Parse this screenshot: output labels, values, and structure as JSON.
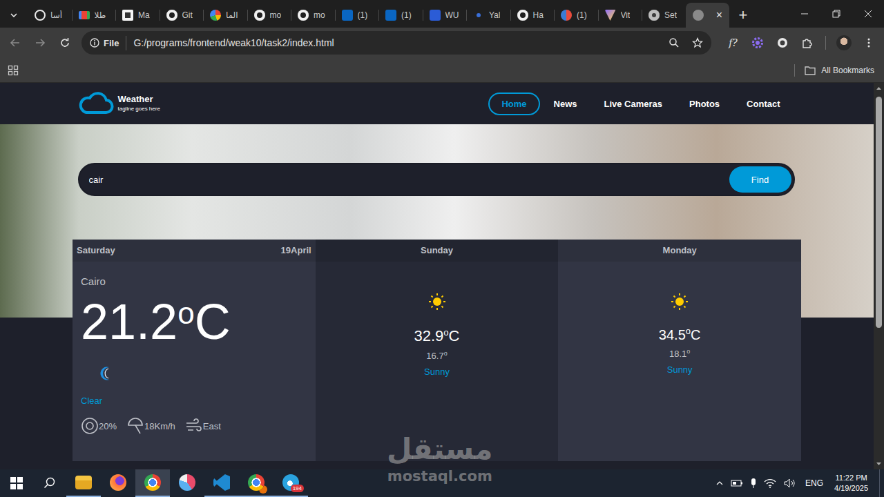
{
  "browser": {
    "tabs": [
      {
        "label": "أسا",
        "kind": "chatgpt",
        "selected": false
      },
      {
        "label": "طلا",
        "kind": "gmail",
        "selected": false
      },
      {
        "label": "Ma",
        "kind": "wiki",
        "selected": false
      },
      {
        "label": "Git",
        "kind": "github",
        "selected": false
      },
      {
        "label": "الما",
        "kind": "google",
        "selected": false
      },
      {
        "label": "mo",
        "kind": "github",
        "selected": false
      },
      {
        "label": "mo",
        "kind": "github",
        "selected": false
      },
      {
        "label": "(1)",
        "kind": "linkedin",
        "selected": false
      },
      {
        "label": "(1)",
        "kind": "linkedin",
        "selected": false
      },
      {
        "label": "WU",
        "kind": "word",
        "selected": false
      },
      {
        "label": "Yal",
        "kind": "yale",
        "selected": false
      },
      {
        "label": "Ha",
        "kind": "github",
        "selected": false
      },
      {
        "label": "(1)",
        "kind": "grammarly",
        "selected": false
      },
      {
        "label": "Vit",
        "kind": "vite",
        "selected": false
      },
      {
        "label": "Set",
        "kind": "settings",
        "selected": false
      },
      {
        "label": "",
        "kind": "globe",
        "selected": true
      }
    ],
    "tab_close": "×",
    "new_tab": "+",
    "address": {
      "scheme_label": "File",
      "url": "G:/programs/frontend/weak10/task2/index.html"
    },
    "extension_label": "f?",
    "bookmarks": {
      "label": "All Bookmarks"
    }
  },
  "page": {
    "brand": {
      "name": "Weather",
      "tagline": "tagline goes here"
    },
    "nav": [
      {
        "label": "Home",
        "selected": true
      },
      {
        "label": "News",
        "selected": false
      },
      {
        "label": "Live Cameras",
        "selected": false
      },
      {
        "label": "Photos",
        "selected": false
      },
      {
        "label": "Contact",
        "selected": false
      }
    ],
    "search": {
      "value": "cair",
      "button": "Find"
    },
    "today": {
      "day": "Saturday",
      "date": "19April",
      "city": "Cairo",
      "temp": "21.2",
      "degree": "o",
      "unit": "C",
      "condition": "Clear",
      "stats": [
        {
          "kind": "rain",
          "value": "20%"
        },
        {
          "kind": "wind",
          "value": "18Km/h"
        },
        {
          "kind": "direction",
          "value": "East"
        }
      ]
    },
    "forecast": [
      {
        "day": "Sunday",
        "max": "32.9",
        "min": "16.7",
        "degree": "o",
        "unit": "C",
        "condition": "Sunny"
      },
      {
        "day": "Monday",
        "max": "34.5",
        "min": "18.1",
        "degree": "o",
        "unit": "C",
        "condition": "Sunny"
      }
    ],
    "scrollbar": {
      "level": 0.64
    }
  },
  "taskbar": {
    "apps": [
      {
        "kind": "explorer",
        "selected": false,
        "running": true,
        "badge": ""
      },
      {
        "kind": "firefox",
        "selected": false,
        "running": false,
        "badge": ""
      },
      {
        "kind": "chrome",
        "selected": true,
        "running": true,
        "badge": ""
      },
      {
        "kind": "snipping",
        "selected": false,
        "running": false,
        "badge": ""
      },
      {
        "kind": "vscode",
        "selected": false,
        "running": true,
        "badge": ""
      },
      {
        "kind": "chrome-profile",
        "selected": false,
        "running": true,
        "badge": ""
      },
      {
        "kind": "telegram",
        "selected": false,
        "running": true,
        "badge": "194"
      }
    ],
    "tray": {
      "language": "ENG",
      "time": "11:22 PM",
      "date": "4/19/2025"
    }
  },
  "watermark": {
    "arabic": "مستقل",
    "latin": "mostaql.com"
  }
}
